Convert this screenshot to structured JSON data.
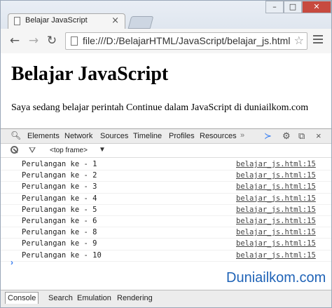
{
  "browser": {
    "tab_title": "Belajar JavaScript",
    "tab_close": "×",
    "url": "file:///D:/BelajarHTML/JavaScript/belajar_js.html",
    "window_controls": {
      "minimize": "–",
      "maximize": "□",
      "close": "✕"
    }
  },
  "page": {
    "heading": "Belajar JavaScript",
    "paragraph": "Saya sedang belajar perintah Continue dalam JavaScript di duniailkom.com"
  },
  "devtools": {
    "tabs": [
      "Elements",
      "Network",
      "Sources",
      "Timeline",
      "Profiles",
      "Resources"
    ],
    "more": "»",
    "frame_select": "<top frame>",
    "caret": "▼",
    "console_rows": [
      {
        "message": "Perulangan ke - 1",
        "source": "belajar_js.html:15"
      },
      {
        "message": "Perulangan ke - 2",
        "source": "belajar_js.html:15"
      },
      {
        "message": "Perulangan ke - 3",
        "source": "belajar_js.html:15"
      },
      {
        "message": "Perulangan ke - 4",
        "source": "belajar_js.html:15"
      },
      {
        "message": "Perulangan ke - 5",
        "source": "belajar_js.html:15"
      },
      {
        "message": "Perulangan ke - 6",
        "source": "belajar_js.html:15"
      },
      {
        "message": "Perulangan ke - 8",
        "source": "belajar_js.html:15"
      },
      {
        "message": "Perulangan ke - 9",
        "source": "belajar_js.html:15"
      },
      {
        "message": "Perulangan ke - 10",
        "source": "belajar_js.html:15"
      }
    ],
    "prompt": "›",
    "drawer_tabs": [
      "Console",
      "Search",
      "Emulation",
      "Rendering"
    ]
  },
  "watermark": "Duniailkom.com"
}
